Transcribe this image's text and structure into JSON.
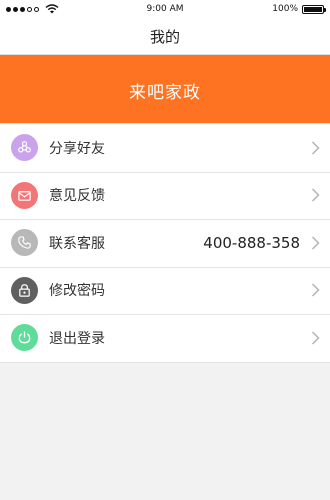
{
  "status_bar": {
    "time": "9:00 AM",
    "battery": "100%",
    "battery_level": 1.0
  },
  "nav": {
    "title": "我的"
  },
  "banner": {
    "title": "来吧家政",
    "color": "#fe7322"
  },
  "menu": {
    "items": [
      {
        "label": "分享好友",
        "value": "",
        "icon": "share-icon",
        "color": "#c9a4ec"
      },
      {
        "label": "意见反馈",
        "value": "",
        "icon": "mail-icon",
        "color": "#f27578"
      },
      {
        "label": "联系客服",
        "value": "400-888-358",
        "icon": "phone-icon",
        "color": "#b8b8b8"
      },
      {
        "label": "修改密码",
        "value": "",
        "icon": "lock-icon",
        "color": "#606060"
      },
      {
        "label": "退出登录",
        "value": "",
        "icon": "power-icon",
        "color": "#5fdc9a"
      }
    ]
  }
}
